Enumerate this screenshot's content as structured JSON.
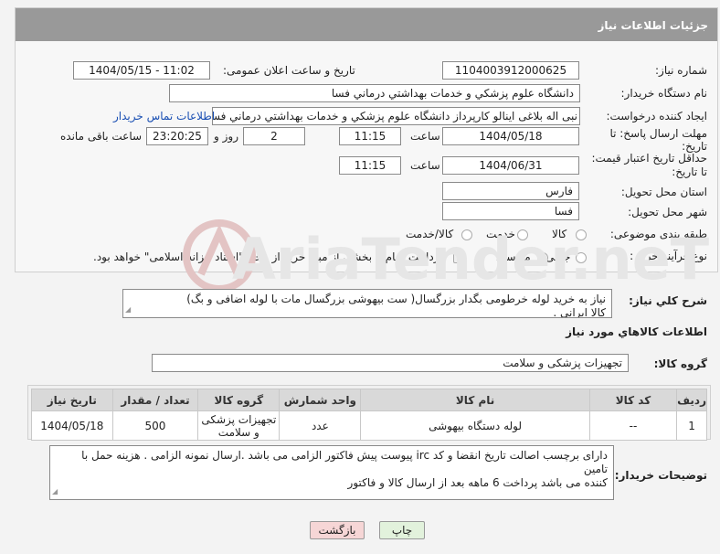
{
  "header": {
    "title": "جزئیات اطلاعات نیاز"
  },
  "fields": {
    "need_number_label": "شماره نیاز:",
    "need_number": "1104003912000625",
    "announce_label": "تاریخ و ساعت اعلان عمومی:",
    "announce_value": "1404/05/15 - 11:02",
    "buyer_org_label": "نام دستگاه خریدار:",
    "buyer_org": "دانشگاه علوم پزشکي و خدمات بهداشتي درماني فسا",
    "creator_label": "ایجاد کننده درخواست:",
    "creator": "نبی اله بلاغی اینالو کارپرداز دانشگاه علوم پزشکي و خدمات بهداشتي درماني فسا",
    "contact_link": "اطلاعات تماس خریدار",
    "deadline_label_1": "مهلت ارسال پاسخ: تا",
    "deadline_label_2": "تاریخ:",
    "deadline_date": "1404/05/18",
    "hour_label": "ساعت",
    "deadline_time": "11:15",
    "days_value": "2",
    "days_label": "روز و",
    "remaining_time": "23:20:25",
    "remaining_label": "ساعت باقی مانده",
    "validity_label_1": "حداقل تاریخ اعتبار قیمت:",
    "validity_label_2": "تا تاریخ:",
    "validity_date": "1404/06/31",
    "validity_hour_label": "ساعت",
    "validity_time": "11:15",
    "province_label": "استان محل تحویل:",
    "province": "فارس",
    "city_label": "شهر محل تحویل:",
    "city": "فسا",
    "category_label": "طبقه بندی موضوعی:",
    "category_options": [
      "کالا",
      "خدمت",
      "کالا/خدمت"
    ],
    "process_label": "نوع فرآیند خرید :",
    "process_options": [
      "جزیی",
      "متوسط"
    ],
    "payment_note": "پرداخت تمام یا بخشی از مبلغ خرید،از محل \"اسناد خزانه اسلامی\" خواهد بود."
  },
  "summary": {
    "label": "شرح کلي نياز:",
    "text_line1": "نیاز به خرید لوله خرطومی بگدار بزرگسال( ست بیهوشی بزرگسال  مات با لوله اضافی و بگ)",
    "text_line2": "کالا ایرانی ."
  },
  "goods_info_title": "اطلاعات کالاهاي مورد نياز",
  "goods_group": {
    "label": "گروه کالا:",
    "value": "تجهیزات پزشکی و سلامت"
  },
  "table": {
    "headers": [
      "ردیف",
      "کد کالا",
      "نام کالا",
      "واحد شمارش",
      "گروه کالا",
      "تعداد / مقدار",
      "تاریخ نیاز"
    ],
    "rows": [
      [
        "1",
        "--",
        "لوله دستگاه بیهوشی",
        "عدد",
        "تجهیزات پزشکی و سلامت",
        "500",
        "1404/05/18"
      ]
    ]
  },
  "buyer_notes": {
    "label": "توضیحات خریدار:",
    "line1": "دارای برچسب اصالت تاریخ انقضا و کد irc  پیوست پیش فاکتور الزامی می باشد .ارسال نمونه الزامی . هزینه حمل با تامین",
    "line2": "کننده می باشد پرداخت 6 ماهه بعد از ارسال کالا و فاکتور"
  },
  "buttons": {
    "print": "چاپ",
    "back": "بازگشت"
  },
  "watermark": {
    "text": "AriaTender.neT"
  },
  "colors": {
    "header_bg": "#999999",
    "link": "#1a4fb3",
    "back_btn_bg": "#f6d6d6",
    "print_btn_bg": "#e2f2dc"
  }
}
